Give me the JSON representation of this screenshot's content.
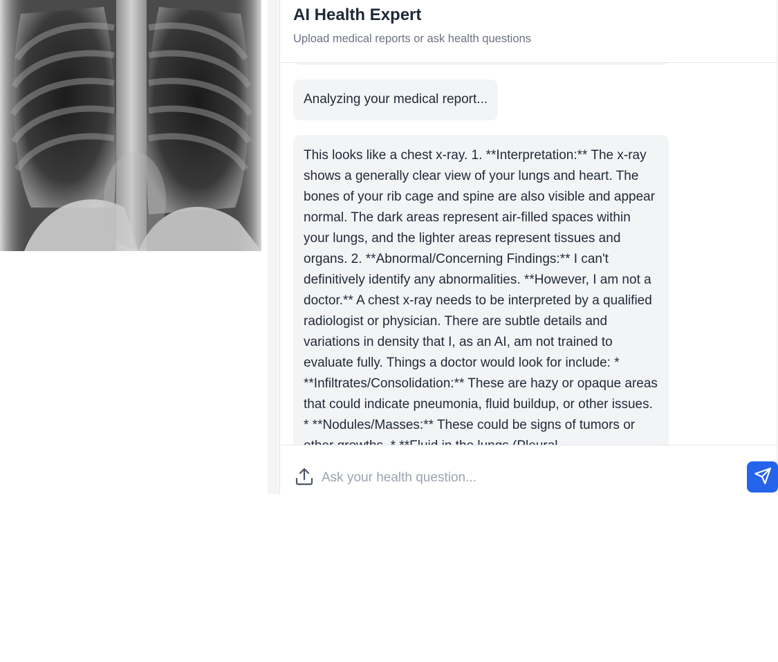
{
  "header": {
    "title": "AI Health Expert",
    "subtitle": "Upload medical reports or ask health questions"
  },
  "messages": [
    {
      "role": "assistant",
      "text": "Analyzing your medical report..."
    },
    {
      "role": "assistant",
      "text": "This looks like a chest x-ray. 1. **Interpretation:** The x-ray shows a generally clear view of your lungs and heart. The bones of your rib cage and spine are also visible and appear normal. The dark areas represent air-filled spaces within your lungs, and the lighter areas represent tissues and organs. 2. **Abnormal/Concerning Findings:** I can't definitively identify any abnormalities. **However, I am not a doctor.** A chest x-ray needs to be interpreted by a qualified radiologist or physician. There are subtle details and variations in density that I, as an AI, am not trained to evaluate fully. Things a doctor would look for include: * **Infiltrates/Consolidation:** These are hazy or opaque areas that could indicate pneumonia, fluid buildup, or other issues. * **Nodules/Masses:** These could be signs of tumors or other growths. * **Fluid in the lungs (Pleural"
    }
  ],
  "input": {
    "placeholder": "Ask your health question...",
    "value": ""
  },
  "icons": {
    "upload": "upload-icon",
    "send": "send-icon"
  },
  "colors": {
    "accent": "#2563eb",
    "bubble": "#f3f4f6",
    "text": "#1f2937",
    "muted": "#6b7280"
  }
}
